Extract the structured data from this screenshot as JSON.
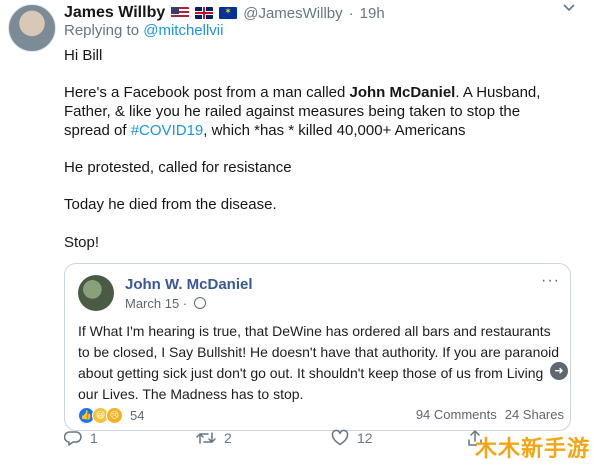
{
  "tweet": {
    "author": "James Willby",
    "handle": "@JamesWillby",
    "time": "19h",
    "reply_prefix": "Replying to ",
    "reply_mention": "@mitchellvii",
    "lines": {
      "greeting": "Hi Bill",
      "p2_a": "Here's a Facebook post from a man called ",
      "p2_bold": "John McDaniel",
      "p2_b": ". A Husband, Father, & like you he railed against measures being taken to stop the spread of ",
      "p2_hashtag": "#COVID19",
      "p2_c": ", which *has * killed 40,000+ Americans",
      "p3": "He protested, called for resistance",
      "p4": "Today he died from the disease.",
      "p5": "Stop!"
    },
    "actions": {
      "replies": "1",
      "retweets": "2",
      "likes": "12"
    }
  },
  "fb_post": {
    "name": "John W. McDaniel",
    "date": "March 15 · ",
    "text": "If What I'm hearing is true, that DeWine has ordered all bars and restaurants to be closed, I Say Bullshit! He doesn't have that authority. If you are paranoid about getting sick just don't go out. It shouldn't keep those of us from Living our Lives. The Madness has to stop.",
    "reactions": "54",
    "comments": "94 Comments",
    "shares": "24 Shares",
    "more": "···"
  },
  "icons": {
    "more": "chevron-down-icon",
    "reply": "reply-icon",
    "retweet": "retweet-icon",
    "like": "heart-icon",
    "share": "share-icon"
  },
  "watermark": "木木新手游",
  "colors": {
    "link": "#1b95e0",
    "muted": "#657786",
    "fb_link": "#385898"
  }
}
